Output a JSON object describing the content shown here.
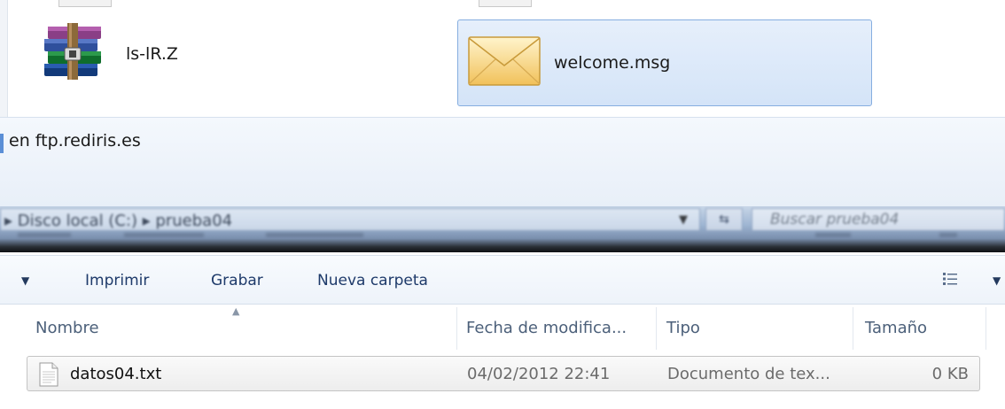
{
  "top_window": {
    "files": [
      {
        "name": "ls-lR.Z",
        "icon": "winrar-archive-icon"
      },
      {
        "name": "welcome.msg",
        "icon": "envelope-icon",
        "selected": true
      }
    ],
    "status_text": "en ftp.rediris.es"
  },
  "address_bar": {
    "path": "▸ Disco local (C:)  ▸  prueba04",
    "search_placeholder": "Buscar prueba04"
  },
  "toolbar": {
    "items": [
      "Imprimir",
      "Grabar",
      "Nueva carpeta"
    ]
  },
  "columns": {
    "name": "Nombre",
    "date": "Fecha de modifica...",
    "type": "Tipo",
    "size": "Tamaño"
  },
  "rows": [
    {
      "name": "datos04.txt",
      "date": "04/02/2012 22:41",
      "type": "Documento de tex...",
      "size": "0 KB",
      "icon": "text-file-icon"
    }
  ],
  "colors": {
    "selection_fill": "#dce8f8",
    "selection_border": "#86aee0",
    "toolbar_text": "#1e3a6a",
    "header_text": "#4c607a"
  }
}
